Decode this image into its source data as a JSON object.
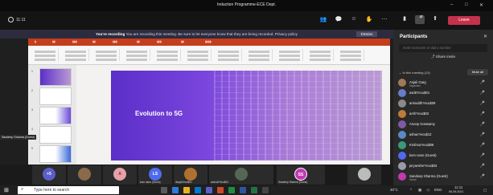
{
  "window": {
    "title": "Induction Programme-ECE Dept.",
    "minimize": "–",
    "restore": "□",
    "close": "✕"
  },
  "toolbar": {
    "timer": "11:11",
    "leave_label": "Leave",
    "leave_color": "#c4314b"
  },
  "banner": {
    "bold_text": "You're recording",
    "text": "You are recording this meeting. Be sure to let everyone know that they are being recorded. Privacy policy",
    "dismiss_label": "Dismiss"
  },
  "share": {
    "slide_title": "Evolution to 5G",
    "speaker_label": "Sandeep Sharma (Guest)",
    "slide_numbers": [
      "1",
      "2",
      "3",
      "4",
      "5"
    ]
  },
  "strip": [
    {
      "initials": "+5",
      "name": "",
      "color": "#5b5fc7"
    },
    {
      "initials": "",
      "name": "",
      "color": "#8a6a4a"
    },
    {
      "initials": "A",
      "name": "",
      "color": "#e8a0a8"
    },
    {
      "initials": "LS",
      "name": "kom nano (Guest)",
      "color": "#4f6bed"
    },
    {
      "initials": "",
      "name": "dsujat?ecu$01",
      "color": "#b07030"
    },
    {
      "initials": "",
      "name": "amrudt?ecu$01",
      "color": "#556655"
    },
    {
      "initials": "SS",
      "name": "Sandeep Sharma (Guest)",
      "color": "#c239b3"
    },
    {
      "initials": "",
      "name": "",
      "color": "#bbbbbb"
    }
  ],
  "panel": {
    "title": "Participants",
    "search_placeholder": "Invite someone or dial a number",
    "share_invite": "Share invite",
    "group_label": "In this meeting (13)",
    "mute_all": "Mute all",
    "participants": [
      {
        "name": "Anjali Garg",
        "sub": "Organiser"
      },
      {
        "name": "asd67ecu$01",
        "sub": ""
      },
      {
        "name": "aniruddh?ecu$09",
        "sub": ""
      },
      {
        "name": "arsh?ecu$02",
        "sub": ""
      },
      {
        "name": "Anoop Goswamy",
        "sub": ""
      },
      {
        "name": "ashan?ecu$12",
        "sub": ""
      },
      {
        "name": "Krishna?ecu$09",
        "sub": ""
      },
      {
        "name": "kom nano (Guest)",
        "sub": ""
      },
      {
        "name": "piryanshe?ecu$03",
        "sub": ""
      },
      {
        "name": "Sandeep Sharma (Guest)",
        "sub": "Guest"
      }
    ]
  },
  "taskbar": {
    "search_text": "Type here to search",
    "temperature": "30°C",
    "language": "ENG",
    "time": "11:11",
    "date": "06-09-2021"
  }
}
